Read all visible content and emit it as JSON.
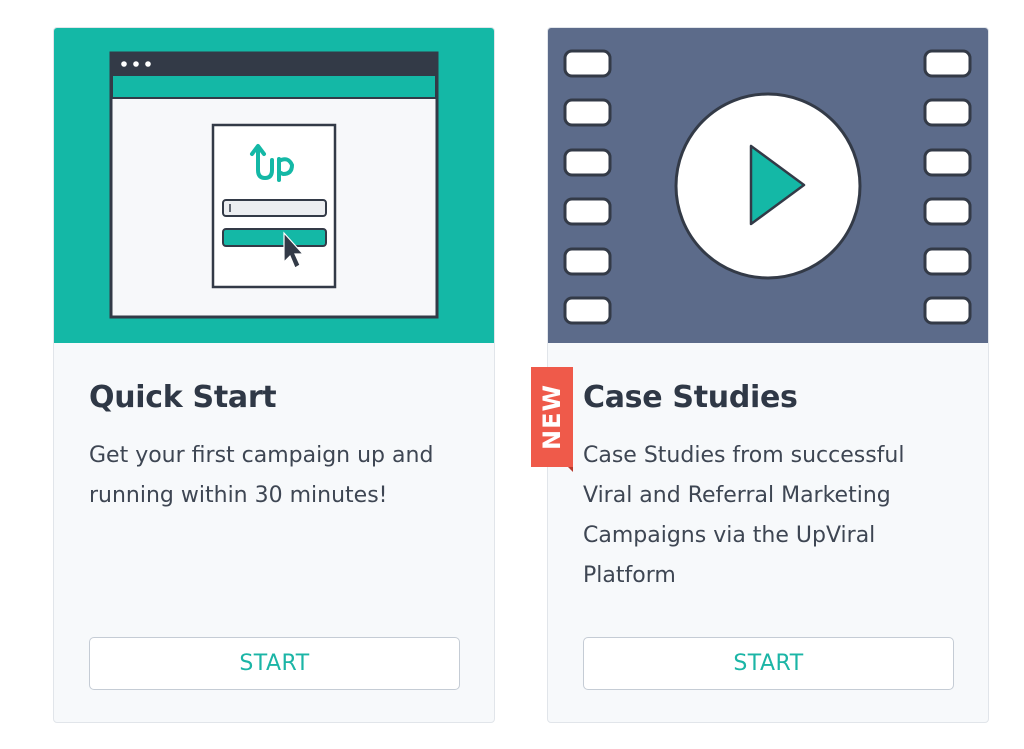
{
  "cards": [
    {
      "title": "Quick Start",
      "description": "Get your first campaign up and running within 30 minutes!",
      "button_label": "START",
      "hero_icon": "quick-start-browser-illustration"
    },
    {
      "title": "Case Studies",
      "description": "Case Studies from successful Viral and Referral Marketing Campaigns via the UpViral Platform",
      "button_label": "START",
      "badge": "NEW",
      "hero_icon": "film-strip-play-illustration"
    }
  ],
  "colors": {
    "teal": "#14b8a6",
    "slate": "#5c6b8a",
    "dark": "#333a47",
    "badge_red": "#ef5a4a",
    "button_text": "#1bb5a6"
  }
}
